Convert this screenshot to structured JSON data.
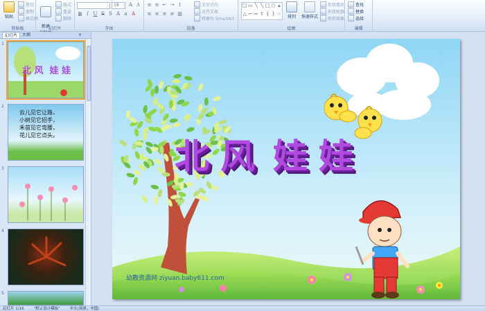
{
  "ribbon": {
    "clipboard": {
      "label": "剪贴板",
      "paste": "粘贴",
      "cut": "剪切",
      "copy": "复制",
      "format": "格式刷"
    },
    "slides": {
      "label": "幻灯片",
      "new_slide": "新建\n幻灯片",
      "layout": "版式",
      "reset": "重设",
      "delete": "删除"
    },
    "font": {
      "label": "字体",
      "font_size": "18"
    },
    "paragraph": {
      "label": "段落",
      "text_direction": "文字方向",
      "align_text": "对齐文本",
      "smartart": "转换为 SmartArt"
    },
    "drawing": {
      "label": "绘图",
      "arrange": "排列",
      "quick_styles": "快速样式",
      "shape_fill": "形状填充",
      "shape_outline": "形状轮廓",
      "shape_effects": "形状效果"
    },
    "editing": {
      "label": "编辑",
      "find": "查找",
      "replace": "替换",
      "select": "选择"
    }
  },
  "pane": {
    "tabs": [
      "幻灯片",
      "大纲"
    ],
    "slides": [
      {
        "num": "1",
        "title": "北 风  娃 娃"
      },
      {
        "num": "2",
        "lines": [
          "云儿见它让路，",
          "小树见它招手，",
          "禾苗见它弯腰，",
          "花儿见它点头。"
        ]
      },
      {
        "num": "3"
      },
      {
        "num": "4"
      },
      {
        "num": "5"
      }
    ]
  },
  "slide": {
    "title_chars": [
      "北",
      "风",
      "娃",
      "娃"
    ],
    "watermark": "幼教资源网 ziyuan.baby611.com"
  },
  "status": {
    "slide_count": "幻灯片 1/16",
    "theme": "\"默认设计模板\"",
    "language": "中文(简体，中国)"
  },
  "colors": {
    "title_purple": "#b04ae0",
    "sky": "#aee3f8",
    "grass": "#8fd64a",
    "trunk": "#c0503a"
  }
}
